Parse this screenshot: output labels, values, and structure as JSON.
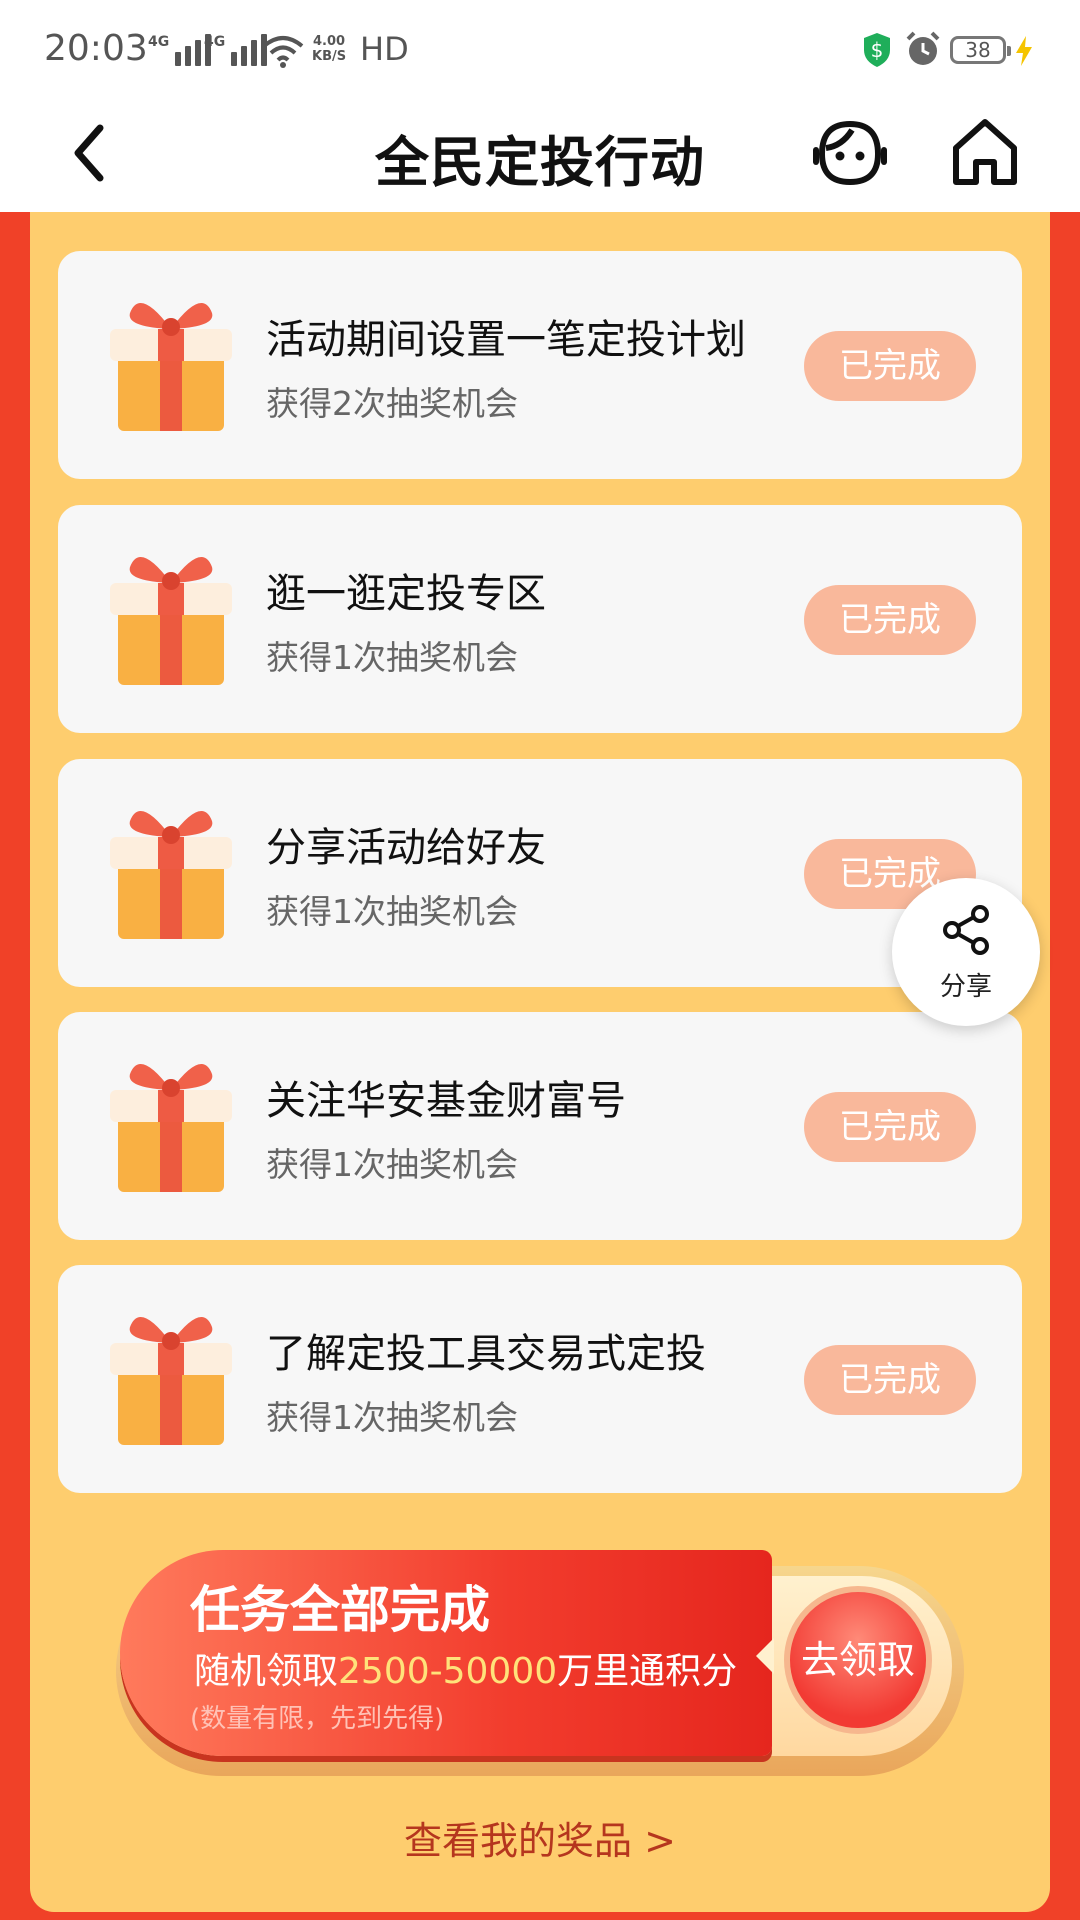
{
  "status_bar": {
    "time": "20:03",
    "network_1": "4G",
    "network_2": "4G",
    "speed_value": "4.00",
    "speed_unit": "KB/S",
    "hd": "HD",
    "battery": "38"
  },
  "nav": {
    "title": "全民定投行动",
    "back_icon": "chevron-left-icon",
    "service_icon": "customer-service-icon",
    "home_icon": "home-icon"
  },
  "tasks": [
    {
      "title": "活动期间设置一笔定投计划",
      "reward": "获得2次抽奖机会",
      "status": "已完成"
    },
    {
      "title": "逛一逛定投专区",
      "reward": "获得1次抽奖机会",
      "status": "已完成"
    },
    {
      "title": "分享活动给好友",
      "reward": "获得1次抽奖机会",
      "status": "已完成"
    },
    {
      "title": "关注华安基金财富号",
      "reward": "获得1次抽奖机会",
      "status": "已完成"
    },
    {
      "title": "了解定投工具交易式定投",
      "reward": "获得1次抽奖机会",
      "status": "已完成"
    }
  ],
  "share": {
    "label": "分享"
  },
  "banner": {
    "title": "任务全部完成",
    "desc_prefix": "随机领取",
    "desc_highlight": "2500-50000",
    "desc_suffix": "万里通积分",
    "note": "(数量有限，先到先得)",
    "claim_label": "去领取"
  },
  "prize_link": "查看我的奖品 >",
  "colors": {
    "page_red": "#f04128",
    "panel_yellow": "#fecd6e",
    "done_button": "#f9b89b",
    "link_red": "#b5361e"
  }
}
